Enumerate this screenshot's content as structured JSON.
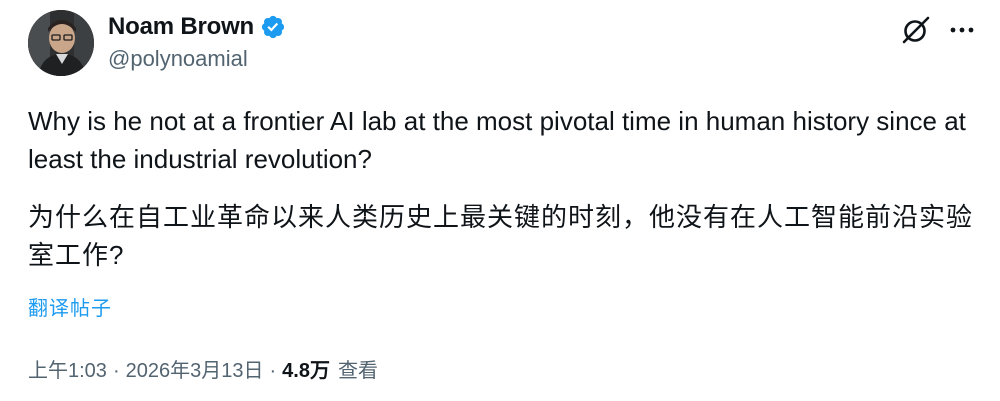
{
  "author": {
    "display_name": "Noam Brown",
    "handle": "@polynoamial",
    "verified_icon": "verified-badge-icon",
    "verified_color": "#1d9bf0"
  },
  "toolbar": {
    "grok_icon": "grok-icon",
    "more_icon": "more-options-icon"
  },
  "tweet": {
    "text_en": "Why is he not at a frontier AI lab at the most pivotal time in human history since at least the industrial revolution?",
    "text_zh": "为什么在自工业革命以来人类历史上最关键的时刻，他没有在人工智能前沿实验室工作?",
    "translate_label": "翻译帖子",
    "time": "上午1:03",
    "separator": "·",
    "date": "2026年3月13日",
    "views_count": "4.8万",
    "views_label": "查看"
  },
  "colors": {
    "text_primary": "#0f1419",
    "text_secondary": "#536471",
    "link": "#1d9bf0"
  }
}
